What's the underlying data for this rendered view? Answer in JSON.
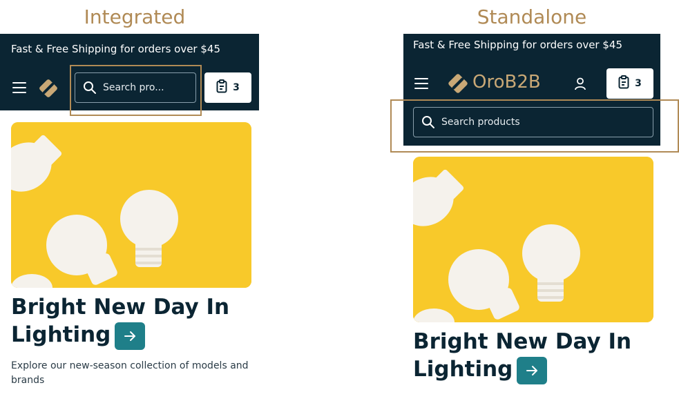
{
  "captions": {
    "integrated": "Integrated",
    "standalone": "Standalone"
  },
  "colors": {
    "header": "#0b2533",
    "accent": "#b08a55",
    "button": "#1f7f89",
    "hero_bg": "#f8c92a"
  },
  "integrated": {
    "promo": "Fast & Free Shipping for orders over $45",
    "search_placeholder": "Search pro...",
    "cart_count": "3",
    "hero_title_line1": "Bright New Day In",
    "hero_title_line2": "Lighting",
    "hero_desc_line1": "Explore our new-season collection of models and",
    "hero_desc_line2": "brands"
  },
  "standalone": {
    "promo": "Fast & Free Shipping for orders over $45",
    "logo_text_a": "Oro",
    "logo_text_b": "B2B",
    "search_placeholder": "Search products",
    "cart_count": "3",
    "hero_title_line1": "Bright New Day In",
    "hero_title_line2": "Lighting"
  },
  "icons": [
    "hamburger-icon",
    "logo-icon",
    "search-icon",
    "clipboard-icon",
    "user-icon",
    "arrow-right-icon"
  ]
}
